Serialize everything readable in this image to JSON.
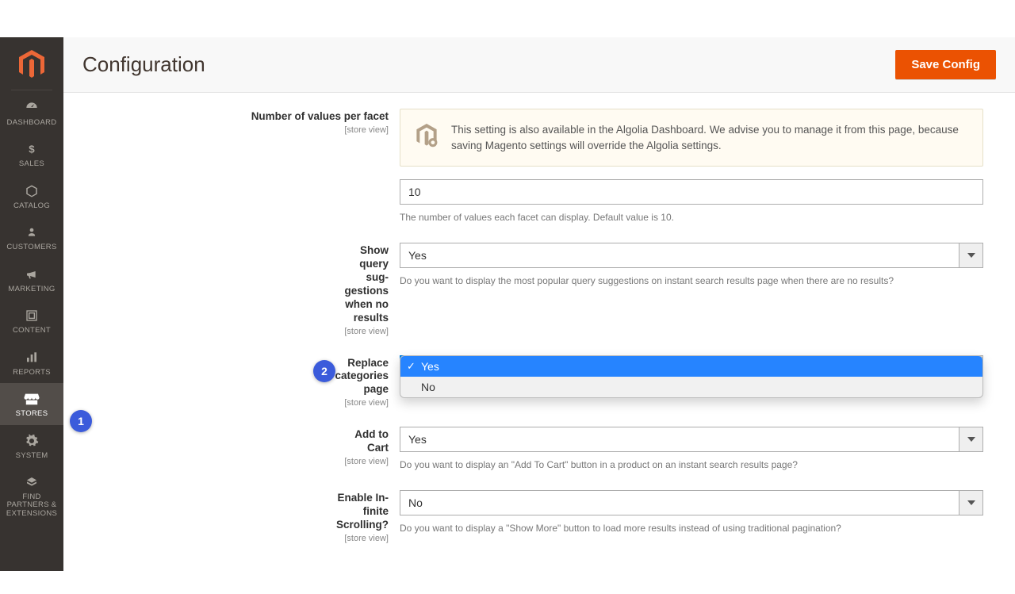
{
  "header": {
    "title": "Configuration",
    "save_label": "Save Config"
  },
  "sidebar": {
    "items": [
      {
        "label": "DASHBOARD"
      },
      {
        "label": "SALES"
      },
      {
        "label": "CATALOG"
      },
      {
        "label": "CUSTOMERS"
      },
      {
        "label": "MARKETING"
      },
      {
        "label": "CONTENT"
      },
      {
        "label": "REPORTS"
      },
      {
        "label": "STORES"
      },
      {
        "label": "SYSTEM"
      },
      {
        "label": "FIND PARTNERS & EXTENSIONS"
      }
    ]
  },
  "scope_text": "[store view]",
  "notice_text": "This setting is also available in the Algolia Dashboard. We advise you to manage it from this page, because saving Magento settings will override the Algolia settings.",
  "fields": {
    "num_values": {
      "label": "Number of values per facet",
      "value": "10",
      "help": "The number of values each facet can display. Default value is 10."
    },
    "suggestions": {
      "label": "Show query suggestions when no results",
      "value": "Yes",
      "help": "Do you want to display the most popular query suggestions on instant search results page when there are no results?"
    },
    "replace_cat": {
      "label": "Replace categories page",
      "options": {
        "yes": "Yes",
        "no": "No"
      }
    },
    "add_to_cart": {
      "label": "Add to Cart",
      "value": "Yes",
      "help": "Do you want to display an \"Add To Cart\" button in a product on an instant search results page?"
    },
    "infinite": {
      "label": "Enable Infinite Scrolling?",
      "value": "No",
      "help": "Do you want to display a \"Show More\" button to load more results instead of using traditional pagination?"
    }
  },
  "markers": {
    "one": "1",
    "two": "2"
  }
}
